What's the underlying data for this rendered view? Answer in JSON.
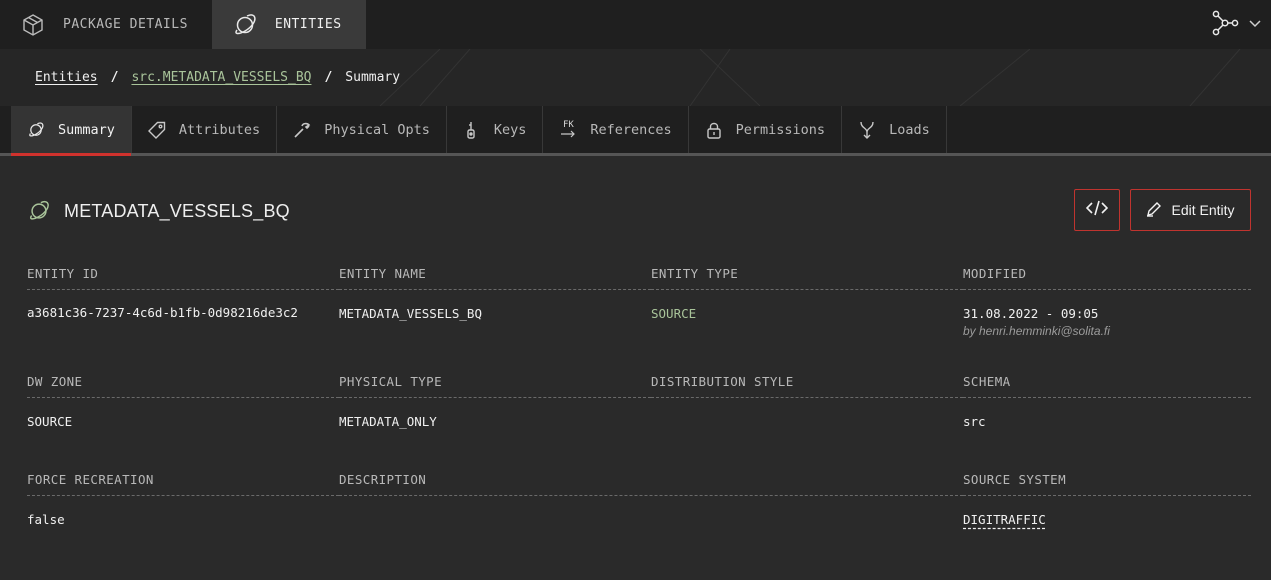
{
  "topbar": {
    "tabs": [
      {
        "label": "PACKAGE DETAILS",
        "icon": "package-icon"
      },
      {
        "label": "ENTITIES",
        "icon": "entity-icon"
      }
    ],
    "right_icons": [
      "graph-icon",
      "chevron-down-icon"
    ]
  },
  "breadcrumb": {
    "items": [
      "Entities",
      "src.METADATA_VESSELS_BQ",
      "Summary"
    ],
    "separator": "/"
  },
  "tabs": [
    {
      "label": "Summary",
      "icon": "entity-icon"
    },
    {
      "label": "Attributes",
      "icon": "tag-icon"
    },
    {
      "label": "Physical Opts",
      "icon": "wrench-icon"
    },
    {
      "label": "Keys",
      "icon": "key-icon"
    },
    {
      "label": "References",
      "icon": "fk-icon",
      "icon_text": "FK"
    },
    {
      "label": "Permissions",
      "icon": "lock-icon"
    },
    {
      "label": "Loads",
      "icon": "merge-icon"
    }
  ],
  "header": {
    "title": "METADATA_VESSELS_BQ",
    "code_button_icon": "code-icon",
    "edit_label": "Edit Entity"
  },
  "details": {
    "entity_id_label": "ENTITY ID",
    "entity_id": "a3681c36-7237-4c6d-b1fb-0d98216de3c2",
    "entity_name_label": "ENTITY NAME",
    "entity_name": "METADATA_VESSELS_BQ",
    "entity_type_label": "ENTITY TYPE",
    "entity_type": "SOURCE",
    "modified_label": "MODIFIED",
    "modified": "31.08.2022 - 09:05",
    "modified_by": "by henri.hemminki@solita.fi",
    "dw_zone_label": "DW ZONE",
    "dw_zone": "SOURCE",
    "physical_type_label": "PHYSICAL TYPE",
    "physical_type": "METADATA_ONLY",
    "distribution_style_label": "DISTRIBUTION STYLE",
    "distribution_style": "",
    "schema_label": "SCHEMA",
    "schema": "src",
    "force_recreation_label": "FORCE RECREATION",
    "force_recreation": "false",
    "description_label": "DESCRIPTION",
    "description": "",
    "source_system_label": "SOURCE SYSTEM",
    "source_system": "DIGITRAFFIC"
  },
  "colors": {
    "accent": "#d0322d",
    "green": "#a9c49a",
    "background": "#2a2a2a"
  }
}
